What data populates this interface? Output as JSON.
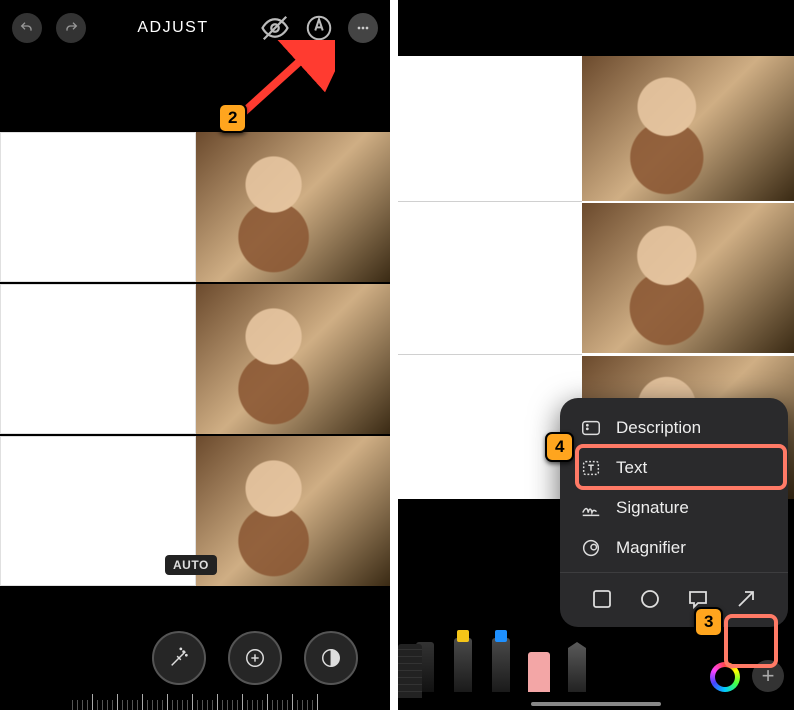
{
  "left": {
    "title": "ADJUST",
    "auto_badge": "AUTO"
  },
  "callouts": {
    "step2": "2",
    "step3": "3",
    "step4": "4"
  },
  "markup_menu": {
    "items": [
      {
        "label": "Description"
      },
      {
        "label": "Text"
      },
      {
        "label": "Signature"
      },
      {
        "label": "Magnifier"
      }
    ]
  }
}
